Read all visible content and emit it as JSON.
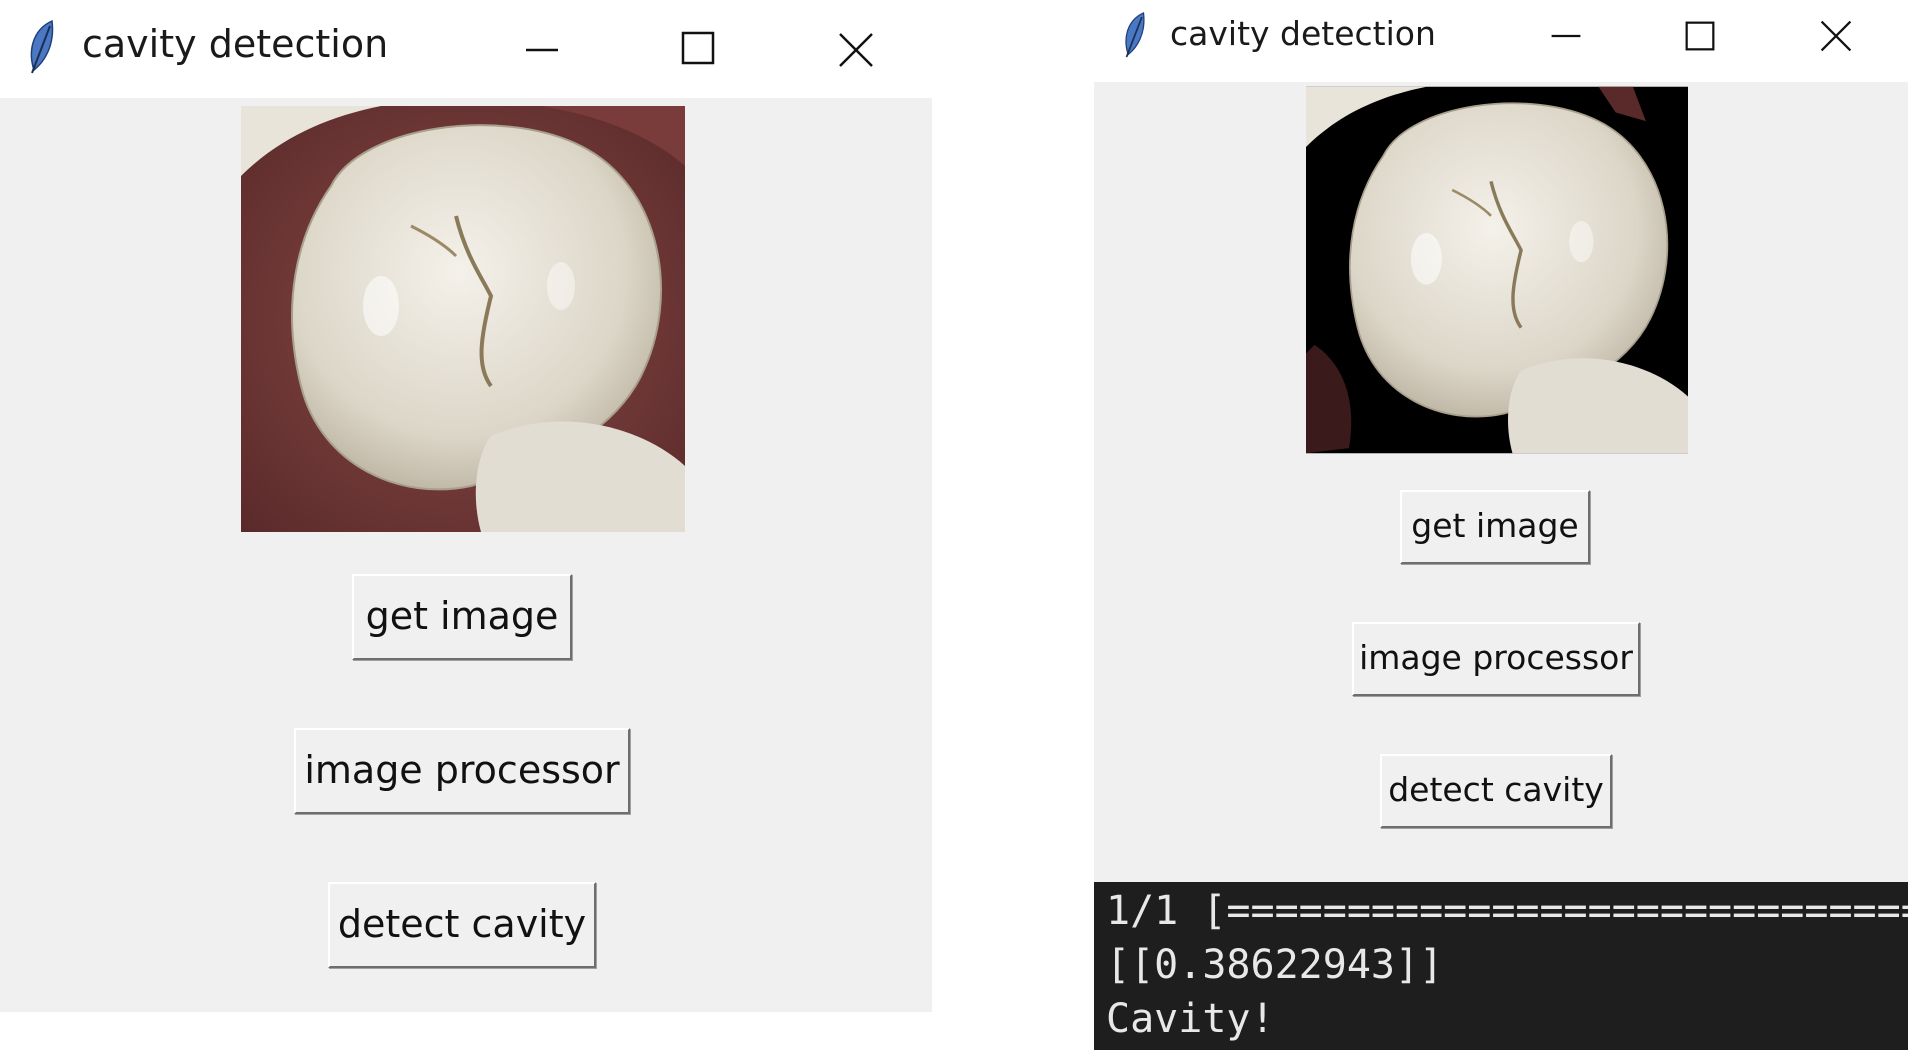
{
  "left_window": {
    "title": "cavity detection",
    "buttons": {
      "get_image": "get image",
      "image_processor": "image processor",
      "detect_cavity": "detect cavity"
    }
  },
  "right_window": {
    "title": "cavity detection",
    "buttons": {
      "get_image": "get image",
      "image_processor": "image processor",
      "detect_cavity": "detect cavity"
    },
    "console_lines": [
      "1/1 [==============================",
      "[[0.38622943]]",
      "Cavity!"
    ]
  },
  "icons": {
    "app": "feather-icon",
    "minimize": "minimize-icon",
    "maximize": "maximize-icon",
    "close": "close-icon"
  }
}
